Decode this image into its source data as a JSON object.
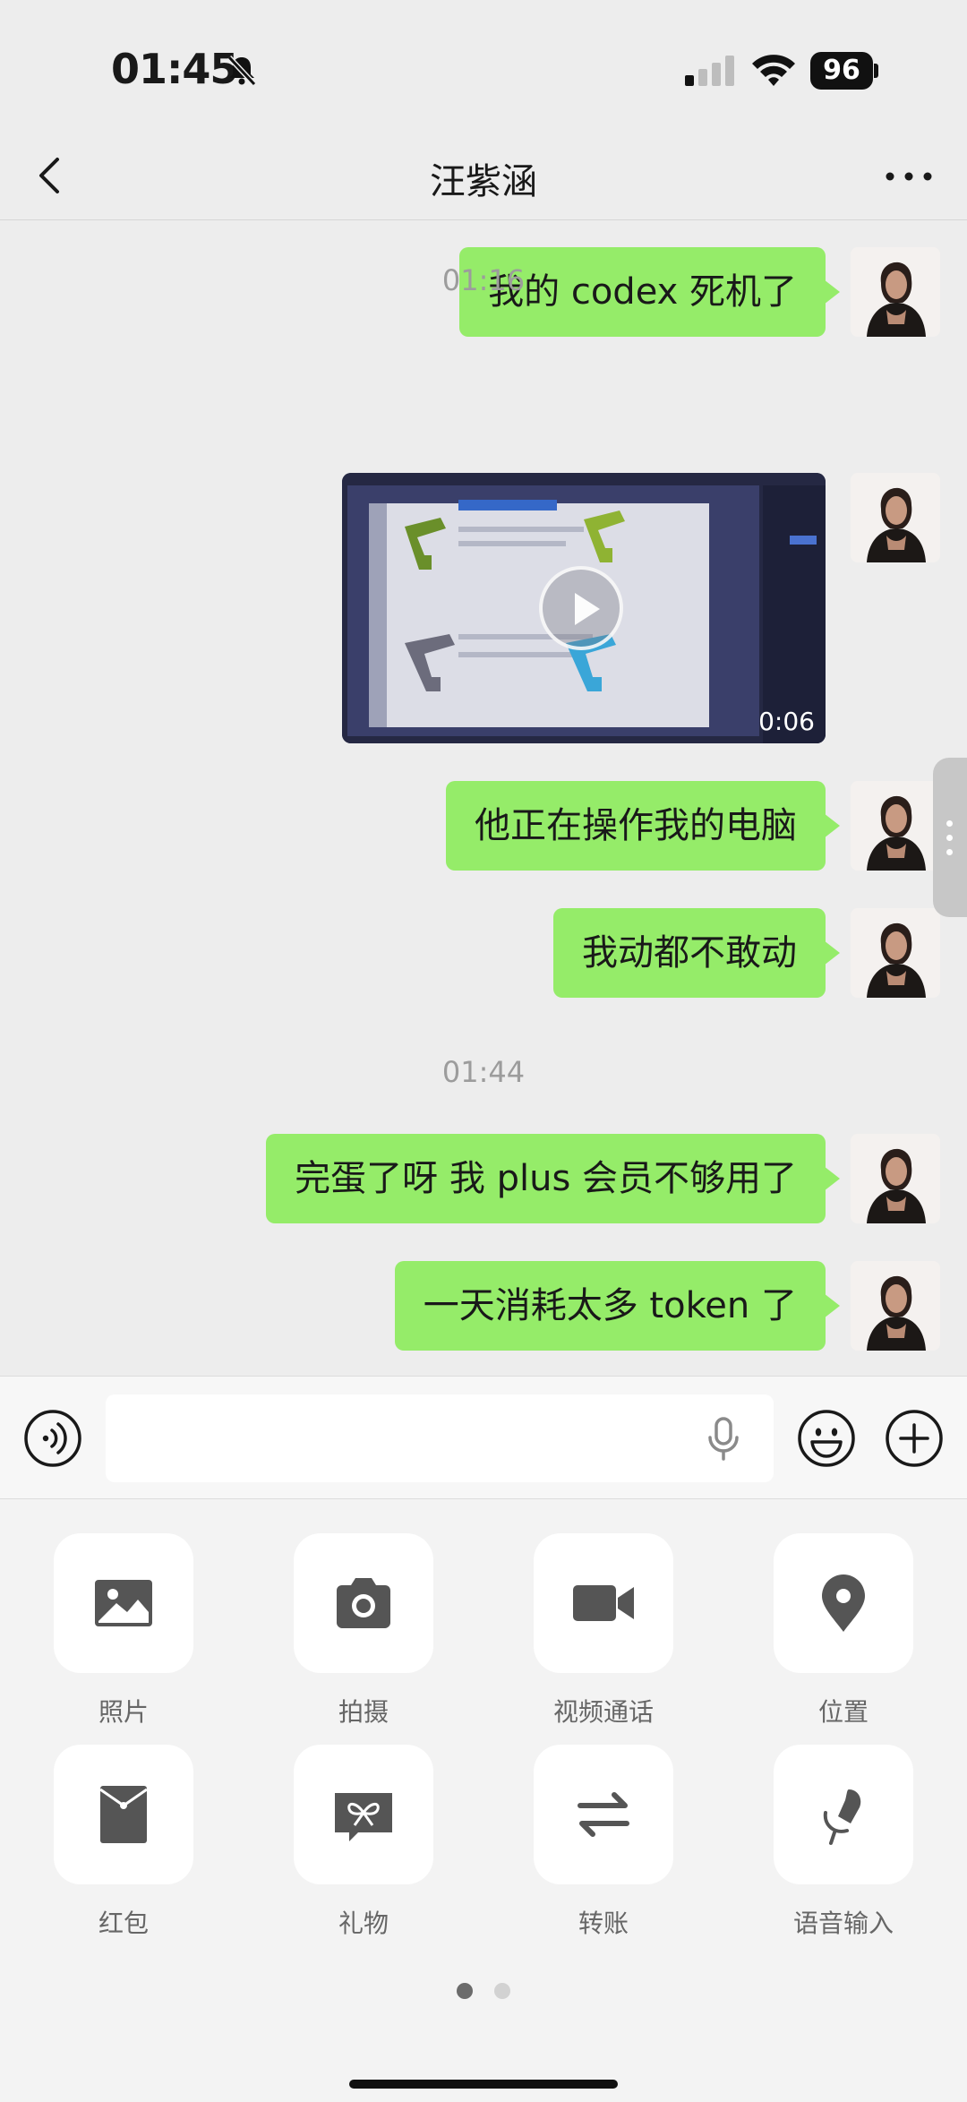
{
  "status_bar": {
    "time": "01:45",
    "battery": "96"
  },
  "nav": {
    "title": "汪紫涵"
  },
  "messages": [
    {
      "type": "text",
      "text": "我的 codex 死机了"
    },
    {
      "type": "timestamp",
      "text": "01:16"
    },
    {
      "type": "video",
      "duration": "0:06"
    },
    {
      "type": "text",
      "text": "他正在操作我的电脑"
    },
    {
      "type": "text",
      "text": "我动都不敢动"
    },
    {
      "type": "timestamp",
      "text": "01:44"
    },
    {
      "type": "text",
      "text": "完蛋了呀 我 plus 会员不够用了"
    },
    {
      "type": "text",
      "text": "一天消耗太多 token 了"
    }
  ],
  "input": {
    "value": ""
  },
  "panel": {
    "items": [
      {
        "label": "照片",
        "icon": "photo-icon"
      },
      {
        "label": "拍摄",
        "icon": "camera-icon"
      },
      {
        "label": "视频通话",
        "icon": "video-call-icon"
      },
      {
        "label": "位置",
        "icon": "location-icon"
      },
      {
        "label": "红包",
        "icon": "red-packet-icon"
      },
      {
        "label": "礼物",
        "icon": "gift-icon"
      },
      {
        "label": "转账",
        "icon": "transfer-icon"
      },
      {
        "label": "语音输入",
        "icon": "voice-input-icon"
      }
    ],
    "page_count": 2,
    "active_page": 1
  },
  "colors": {
    "bubble_green": "#95ec69",
    "background": "#ededed",
    "icon_gray": "#555555"
  }
}
